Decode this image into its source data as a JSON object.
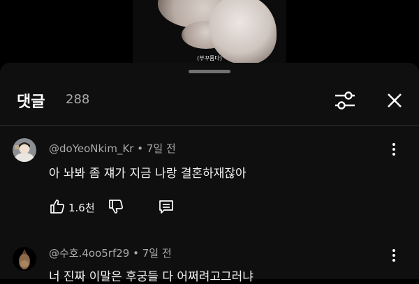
{
  "video": {
    "caption": "(부꾸룸다)"
  },
  "comments_panel": {
    "title": "댓글",
    "count": "288",
    "icons": {
      "filter": "sliders-icon",
      "close": "close-icon"
    }
  },
  "comments": [
    {
      "author": "@doYeoNkim_Kr",
      "time": "7일 전",
      "text": "아 놔봐 좀 쟤가 지금 나랑 결혼하재잖아",
      "likes": "1.6천",
      "icons": [
        "thumbs-up-icon",
        "thumbs-down-icon",
        "reply-icon",
        "more-vertical-icon"
      ]
    },
    {
      "author": "@수호.4oo5rf29",
      "time": "7일 전",
      "text": "너 진짜 이말은 후궁들 다 어쩌려고그러냐",
      "icons": [
        "more-vertical-icon"
      ]
    }
  ],
  "meta_separator": " • "
}
